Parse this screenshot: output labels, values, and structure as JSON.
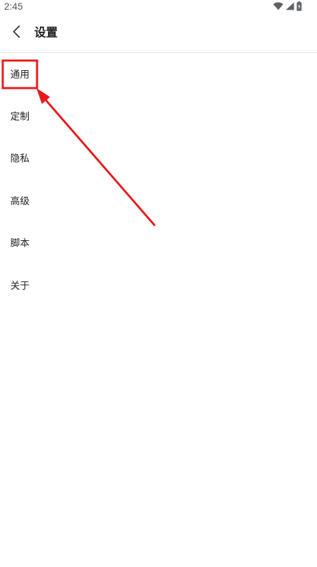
{
  "status_bar": {
    "time": "2:45",
    "icons": [
      "wifi-icon",
      "cellular-signal-icon",
      "battery-charging-icon"
    ]
  },
  "header": {
    "back_icon": "chevron-left-icon",
    "title": "设置"
  },
  "settings": {
    "items": [
      {
        "label": "通用"
      },
      {
        "label": "定制"
      },
      {
        "label": "隐私"
      },
      {
        "label": "高级"
      },
      {
        "label": "脚本"
      },
      {
        "label": "关于"
      }
    ]
  },
  "annotation": {
    "color": "#e8191c",
    "highlighted_item": "通用"
  }
}
